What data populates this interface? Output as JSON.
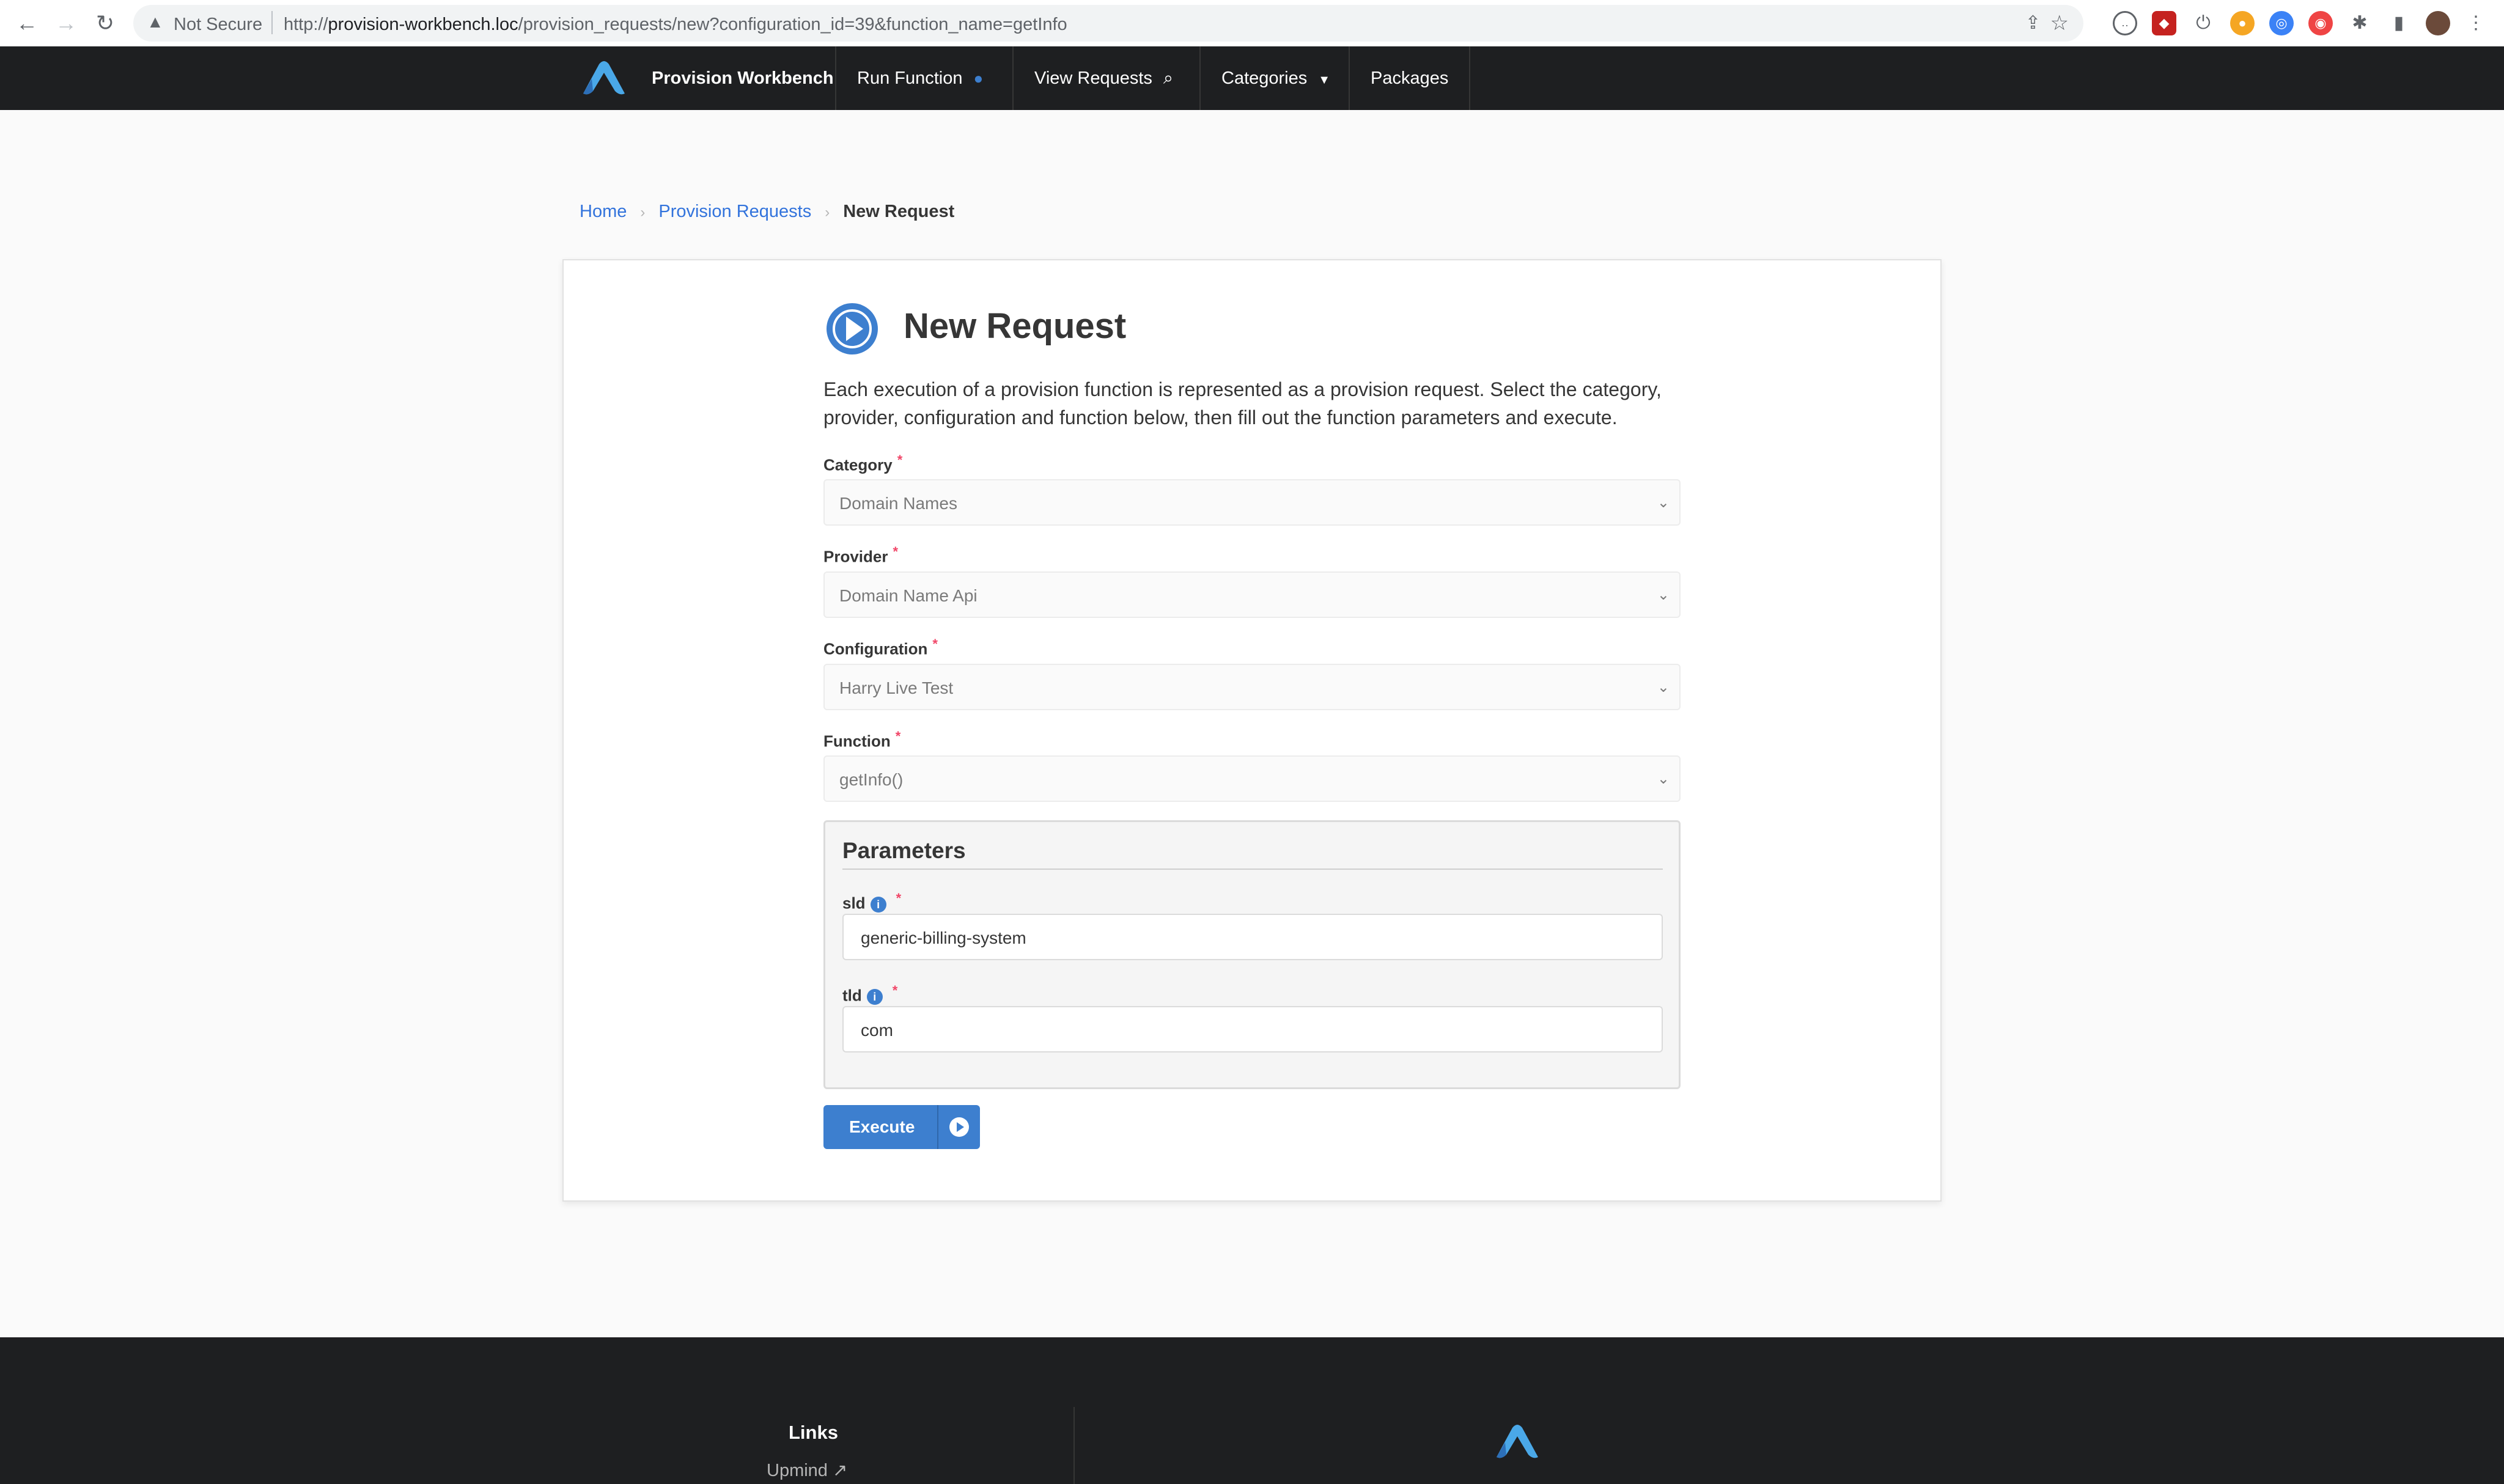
{
  "browser": {
    "security_label": "Not Secure",
    "url_prefix": "http://",
    "url_host": "provision-workbench.loc",
    "url_path": "/provision_requests/new?configuration_id=39&function_name=getInfo"
  },
  "navbar": {
    "brand": "Provision Workbench",
    "items": [
      {
        "label": "Run Function",
        "icon": "play-circle-icon"
      },
      {
        "label": "View Requests",
        "icon": "search-icon"
      },
      {
        "label": "Categories",
        "icon": "caret-down-icon"
      },
      {
        "label": "Packages"
      }
    ]
  },
  "breadcrumb": {
    "home": "Home",
    "section": "Provision Requests",
    "current": "New Request"
  },
  "page": {
    "title": "New Request",
    "intro_line1": "Each execution of a provision function is represented as a provision request. Select the category,",
    "intro_line2": "provider, configuration and function below, then fill out the function parameters and execute."
  },
  "form": {
    "category": {
      "label": "Category",
      "value": "Domain Names"
    },
    "provider": {
      "label": "Provider",
      "value": "Domain Name Api"
    },
    "configuration": {
      "label": "Configuration",
      "value": "Harry Live Test"
    },
    "function": {
      "label": "Function",
      "value": "getInfo()"
    },
    "required_mark": "*"
  },
  "parameters": {
    "title": "Parameters",
    "sld": {
      "label": "sld",
      "value": "generic-billing-system"
    },
    "tld": {
      "label": "tld",
      "value": "com"
    }
  },
  "execute_label": "Execute",
  "footer": {
    "links_title": "Links",
    "link_upmind": "Upmind"
  },
  "colors": {
    "accent": "#3d7fcf",
    "navbar_bg": "#1e1f21",
    "required": "#f14668"
  }
}
